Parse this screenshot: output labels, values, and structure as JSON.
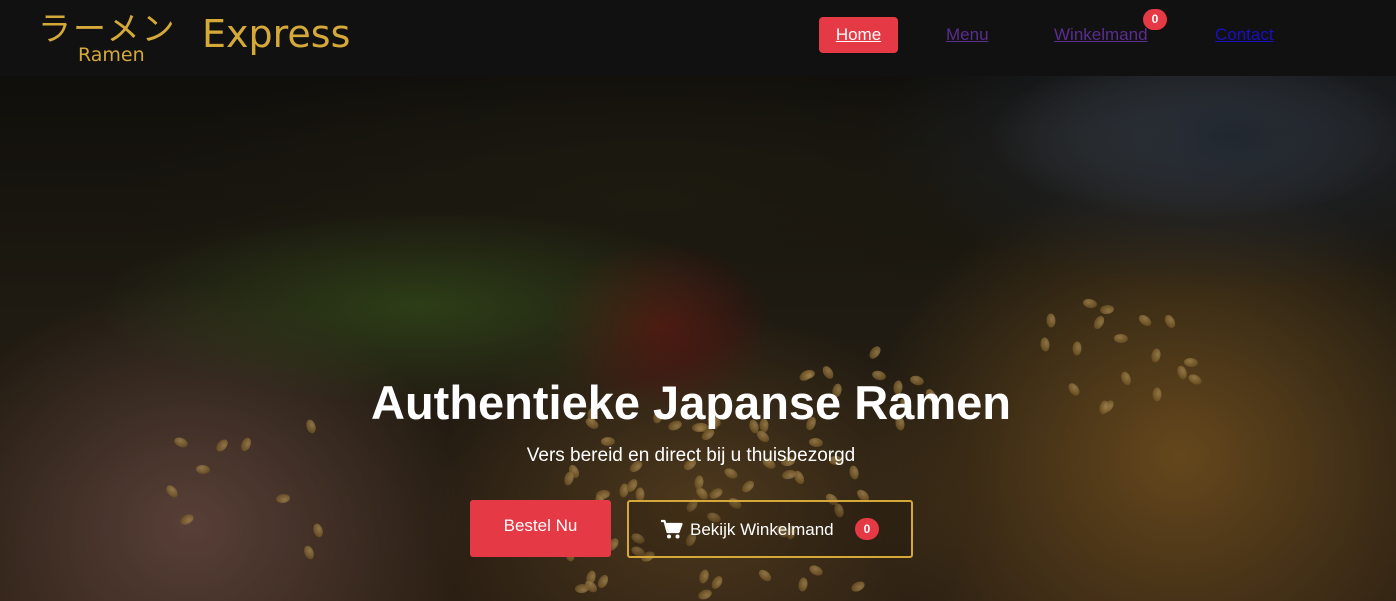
{
  "brand": {
    "japanese": "ラーメン",
    "subtitle": "Ramen",
    "name": "Express",
    "color": "#d4a93a"
  },
  "nav": {
    "home": "Home",
    "menu": "Menu",
    "cart": "Winkelmand",
    "cart_count": "0",
    "contact": "Contact",
    "active": "Home",
    "accent": "#e63946"
  },
  "hero": {
    "title": "Authentieke Japanse Ramen",
    "subtitle": "Vers bereid en direct bij u thuisbezorgd",
    "order_button": "Bestel Nu",
    "cart_button": "Bekijk Winkelmand",
    "cart_button_count": "0",
    "cart_icon": "shopping-cart-icon"
  }
}
